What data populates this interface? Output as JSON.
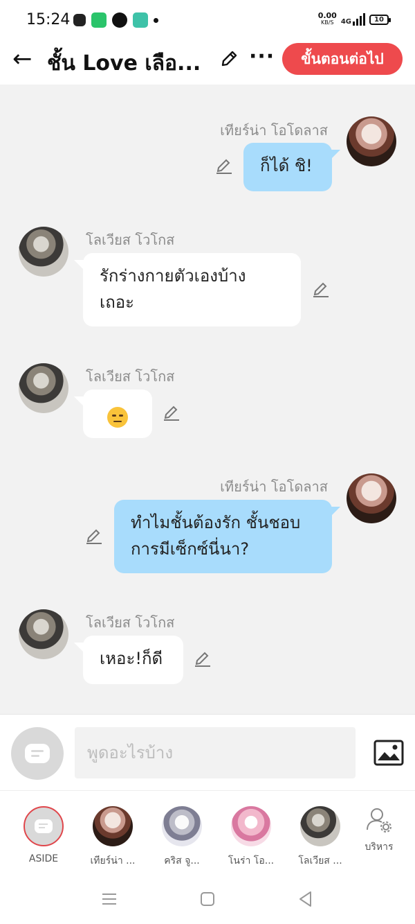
{
  "status": {
    "time": "15:24",
    "net_speed": "0.00",
    "net_unit": "KB/S",
    "network": "4G",
    "battery": "10"
  },
  "header": {
    "title": "ชั้น Love เลือ...",
    "next_label": "ขั้นตอนต่อไป"
  },
  "messages": [
    {
      "sender": "เทียร์น่า โอโดลาส",
      "text": "ก็ได้ ชิ!",
      "side": "right"
    },
    {
      "sender": "โลเวียส โวโกส",
      "text_line1": "รักร่างกายตัวเองบ้าง",
      "text_line2": "เถอะ",
      "side": "left"
    },
    {
      "sender": "โลเวียส โวโกส",
      "emoji": "unamused-face",
      "side": "left"
    },
    {
      "sender": "เทียร์น่า โอโดลาส",
      "text_line1": "ทำไมชั้นต้องรัก ชั้นชอบ",
      "text_line2": "การมีเซ็กซ์นี่นา?",
      "side": "right"
    },
    {
      "sender": "โลเวียส โวโกส",
      "text": "เหอะ!ก็ดี",
      "side": "left"
    }
  ],
  "composer": {
    "placeholder": "พูดอะไรบ้าง"
  },
  "switcher": {
    "items": [
      {
        "label": "ASIDE"
      },
      {
        "label": "เทียร์น่า ..."
      },
      {
        "label": "คริส จู..."
      },
      {
        "label": "โนร่า โอ..."
      },
      {
        "label": "โลเวียส ..."
      },
      {
        "label": "บริหาร"
      }
    ]
  },
  "colors": {
    "accent": "#ee4a4d",
    "my_bubble": "#a8dcfc",
    "other_bubble": "#ffffff",
    "chat_bg": "#f2f2f2"
  }
}
